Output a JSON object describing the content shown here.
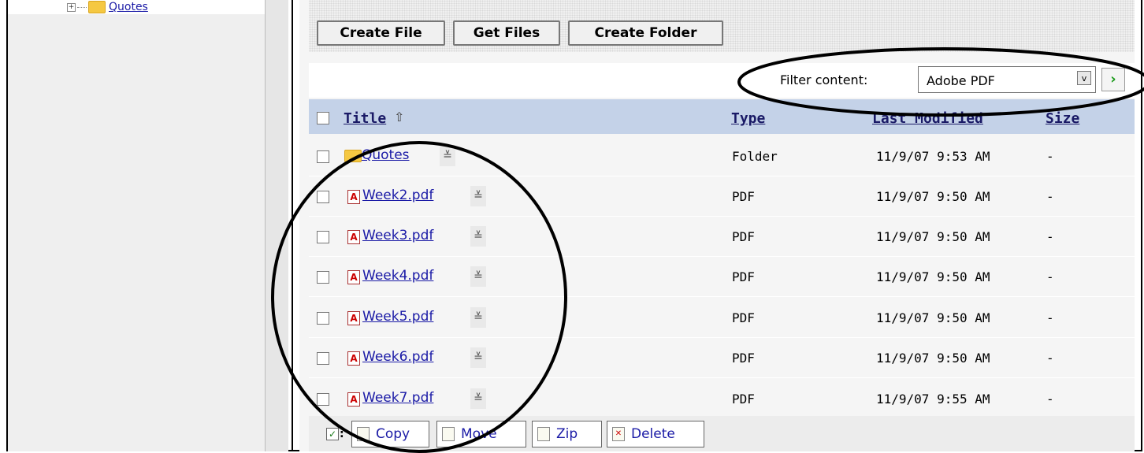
{
  "sidebar": {
    "tree": {
      "expander": "+",
      "label": "Quotes"
    }
  },
  "toolbar": {
    "create_file": "Create File",
    "get_files": "Get Files",
    "create_folder": "Create Folder"
  },
  "filter": {
    "label": "Filter content:",
    "selected": "Adobe PDF",
    "go_symbol": "›",
    "dropdown_symbol": "v"
  },
  "table": {
    "headers": {
      "title": "Title",
      "sort_symbol": "⇧",
      "type": "Type",
      "modified": "Last Modified",
      "size": "Size"
    },
    "rows": [
      {
        "name": "Quotes",
        "kind": "folder",
        "type": "Folder",
        "modified": "11/9/07 9:53 AM",
        "size": "-"
      },
      {
        "name": "Week2.pdf",
        "kind": "pdf",
        "type": "PDF",
        "modified": "11/9/07 9:50 AM",
        "size": "-"
      },
      {
        "name": "Week3.pdf",
        "kind": "pdf",
        "type": "PDF",
        "modified": "11/9/07 9:50 AM",
        "size": "-"
      },
      {
        "name": "Week4.pdf",
        "kind": "pdf",
        "type": "PDF",
        "modified": "11/9/07 9:50 AM",
        "size": "-"
      },
      {
        "name": "Week5.pdf",
        "kind": "pdf",
        "type": "PDF",
        "modified": "11/9/07 9:50 AM",
        "size": "-"
      },
      {
        "name": "Week6.pdf",
        "kind": "pdf",
        "type": "PDF",
        "modified": "11/9/07 9:50 AM",
        "size": "-"
      },
      {
        "name": "Week7.pdf",
        "kind": "pdf",
        "type": "PDF",
        "modified": "11/9/07 9:55 AM",
        "size": "-"
      }
    ]
  },
  "actions": {
    "check_colon": ":",
    "copy": "Copy",
    "move": "Move",
    "zip": "Zip",
    "delete": "Delete"
  },
  "colors": {
    "header_bg": "#c4d2e8",
    "link": "#1a1aa6",
    "go_arrow": "#1a9a1a"
  }
}
